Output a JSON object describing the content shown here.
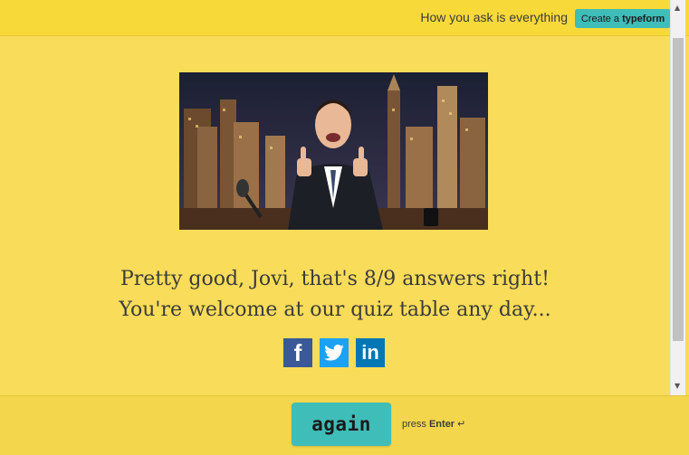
{
  "header": {
    "tagline": "How you ask is everything",
    "cta_prefix": "Create a",
    "cta_brand": "typeform"
  },
  "result": {
    "line1": "Pretty good, Jovi, that's 8/9 answers right!",
    "line2": "You're welcome at our quiz table any day..."
  },
  "social": {
    "facebook_icon": "facebook-icon",
    "twitter_icon": "twitter-icon",
    "linkedin_icon": "linkedin-icon",
    "linkedin_glyph": "in",
    "facebook_glyph": "f"
  },
  "footer": {
    "again_label": "again",
    "hint_prefix": "press",
    "hint_key": "Enter",
    "hint_symbol": "↵"
  },
  "colors": {
    "background": "#f9dc59",
    "accent": "#3fbdb9",
    "text": "#3b3b3b"
  }
}
